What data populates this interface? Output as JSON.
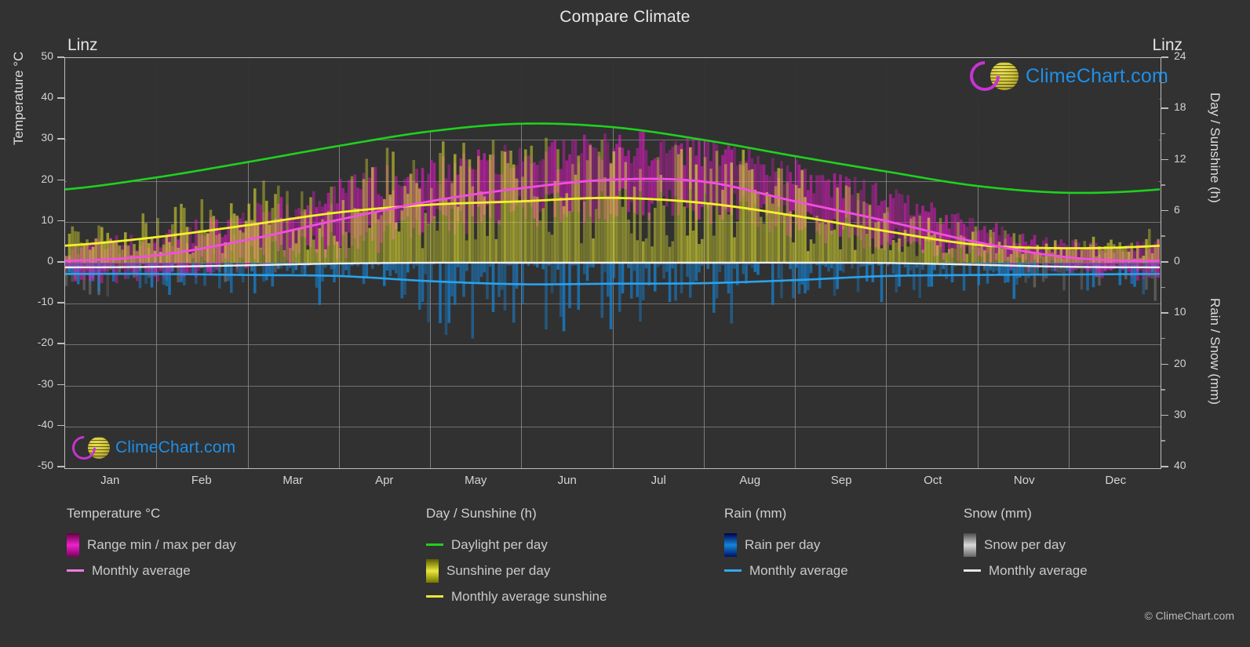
{
  "header": {
    "title": "Compare Climate",
    "city_left": "Linz",
    "city_right": "Linz"
  },
  "brand": {
    "name": "ClimeChart.com",
    "copyright": "© ClimeChart.com"
  },
  "axes": {
    "left_title": "Temperature °C",
    "right_title_top": "Day / Sunshine (h)",
    "right_title_bottom": "Rain / Snow (mm)",
    "left_ticks": [
      "50",
      "40",
      "30",
      "20",
      "10",
      "0",
      "-10",
      "-20",
      "-30",
      "-40",
      "-50"
    ],
    "right_ticks_top": [
      "24",
      "18",
      "12",
      "6",
      "0"
    ],
    "right_ticks_bottom": [
      "10",
      "20",
      "30",
      "40"
    ],
    "x_ticks": [
      "Jan",
      "Feb",
      "Mar",
      "Apr",
      "May",
      "Jun",
      "Jul",
      "Aug",
      "Sep",
      "Oct",
      "Nov",
      "Dec"
    ]
  },
  "legend": {
    "groups": [
      {
        "heading": "Temperature °C",
        "items": [
          {
            "label": "Range min / max per day",
            "kind": "swatch",
            "color": "#ee22cc"
          },
          {
            "label": "Monthly average",
            "kind": "line",
            "color": "#f07ae0"
          }
        ]
      },
      {
        "heading": "Day / Sunshine (h)",
        "items": [
          {
            "label": "Daylight per day",
            "kind": "line",
            "color": "#1ed21e"
          },
          {
            "label": "Sunshine per day",
            "kind": "swatch",
            "color": "#e8e83c"
          },
          {
            "label": "Monthly average sunshine",
            "kind": "line",
            "color": "#e8e83c"
          }
        ]
      },
      {
        "heading": "Rain (mm)",
        "items": [
          {
            "label": "Rain per day",
            "kind": "swatch",
            "color": "#1585d8"
          },
          {
            "label": "Monthly average",
            "kind": "line",
            "color": "#35a7ee"
          }
        ]
      },
      {
        "heading": "Snow (mm)",
        "items": [
          {
            "label": "Snow per day",
            "kind": "swatch",
            "color": "#d8d8d8"
          },
          {
            "label": "Monthly average",
            "kind": "line",
            "color": "#e6e6e6"
          }
        ]
      }
    ]
  },
  "chart_data": {
    "type": "line",
    "title": "Compare Climate",
    "subtitle": "Linz",
    "xlabel": "",
    "ylabel": "Temperature °C",
    "ylim": [
      -50,
      50
    ],
    "y2_top_label": "Day / Sunshine (h)",
    "y2_top_lim": [
      0,
      24
    ],
    "y2_bottom_label": "Rain / Snow (mm)",
    "y2_bottom_lim": [
      0,
      40
    ],
    "grid": true,
    "legend_position": "bottom",
    "categories": [
      "Jan",
      "Feb",
      "Mar",
      "Apr",
      "May",
      "Jun",
      "Jul",
      "Aug",
      "Sep",
      "Oct",
      "Nov",
      "Dec"
    ],
    "series": [
      {
        "name": "Daylight per day",
        "unit": "h",
        "axis": "right-top",
        "color": "#1ed21e",
        "values": [
          8.6,
          10.0,
          11.8,
          13.7,
          15.4,
          16.3,
          15.9,
          14.4,
          12.5,
          10.7,
          9.0,
          8.2
        ]
      },
      {
        "name": "Monthly average sunshine",
        "unit": "h",
        "axis": "right-top",
        "color": "#e8e83c",
        "values": [
          2.0,
          3.0,
          4.4,
          5.9,
          6.8,
          7.2,
          7.6,
          7.0,
          5.5,
          3.7,
          2.1,
          1.7
        ]
      },
      {
        "name": "Monthly average temperature",
        "unit": "°C",
        "axis": "left",
        "color": "#f07ae0",
        "values": [
          0.5,
          1.8,
          5.6,
          10.5,
          15.0,
          18.2,
          20.3,
          19.8,
          15.0,
          10.2,
          5.0,
          1.3
        ]
      },
      {
        "name": "Rain monthly average",
        "unit": "mm",
        "axis": "right-bottom",
        "color": "#35a7ee",
        "values": [
          2.2,
          2.2,
          2.4,
          2.6,
          3.6,
          4.2,
          4.1,
          4.0,
          3.4,
          2.6,
          2.4,
          2.3
        ]
      },
      {
        "name": "Snow monthly average",
        "unit": "mm",
        "axis": "right-bottom",
        "color": "#e6e6e6",
        "values": [
          0.9,
          0.8,
          0.5,
          0.15,
          0.0,
          0.0,
          0.0,
          0.0,
          0.0,
          0.05,
          0.4,
          0.8
        ]
      },
      {
        "name": "Temperature range max per day",
        "unit": "°C",
        "axis": "left",
        "color": "#ee22cc",
        "values": [
          3.0,
          5.0,
          10.0,
          16.0,
          21.0,
          24.0,
          26.5,
          26.0,
          20.5,
          14.5,
          8.0,
          3.8
        ]
      },
      {
        "name": "Temperature range min per day",
        "unit": "°C",
        "axis": "left",
        "color": "#ee22cc",
        "values": [
          -2.5,
          -2.0,
          1.0,
          5.0,
          9.5,
          12.8,
          14.5,
          14.2,
          10.0,
          6.0,
          2.0,
          -1.3
        ]
      }
    ]
  }
}
